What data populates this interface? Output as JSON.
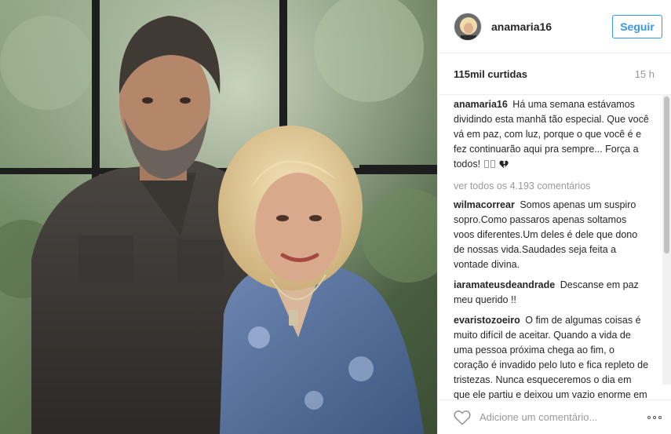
{
  "post": {
    "author": "anamaria16",
    "follow_label": "Seguir",
    "likes": "115mil curtidas",
    "time": "15 h",
    "caption": {
      "user": "anamaria16",
      "text": "Há uma semana estávamos dividindo esta manhã tão especial. Que você vá em paz, com luz, porque o que você é e fez continuarão aqui pra sempre... Força a todos! "
    },
    "view_all": "ver todos os 4.193 comentários",
    "comments": [
      {
        "user": "wilmacorrear",
        "text": "Somos apenas um suspiro sopro.Como passaros apenas soltamos voos diferentes.Um deles é dele que dono de nossas vida.Saudades seja feita a vontade divina."
      },
      {
        "user": "iaramateusdeandrade",
        "text": "Descanse em paz meu querido !!"
      },
      {
        "user": "evaristozoeiro",
        "text": "O fim de algumas coisas é muito difícil de aceitar. Quando a vida de uma pessoa próxima chega ao fim, o coração é invadido pelo luto e fica repleto de tristezas. Nunca esqueceremos o dia em que ele partiu e deixou um vazio enorme em nossas vidas."
      }
    ],
    "comment_placeholder": "Adicione um comentário...",
    "icons": {
      "like": "heart-outline-icon",
      "more": "more-options-icon",
      "broken_heart": "broken-heart-icon"
    },
    "colors": {
      "accent": "#3897f0",
      "muted": "#999999",
      "text": "#262626"
    }
  }
}
